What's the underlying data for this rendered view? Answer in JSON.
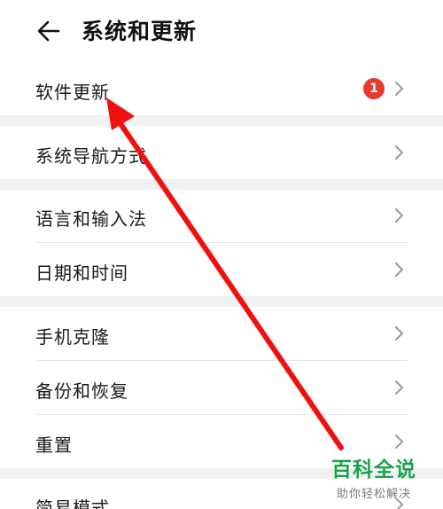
{
  "header": {
    "title": "系统和更新"
  },
  "items": [
    {
      "label": "软件更新",
      "badge": "1"
    },
    {
      "label": "系统导航方式"
    },
    {
      "label": "语言和输入法"
    },
    {
      "label": "日期和时间"
    },
    {
      "label": "手机克隆"
    },
    {
      "label": "备份和恢复"
    },
    {
      "label": "重置"
    },
    {
      "label": "简易模式"
    }
  ],
  "watermark": {
    "title": "百科全说",
    "subtitle": "助你轻松解决"
  },
  "colors": {
    "badge": "#e8382f",
    "arrow": "#f01010",
    "separator": "#f1f1f1",
    "watermark": "#1aa24a"
  }
}
